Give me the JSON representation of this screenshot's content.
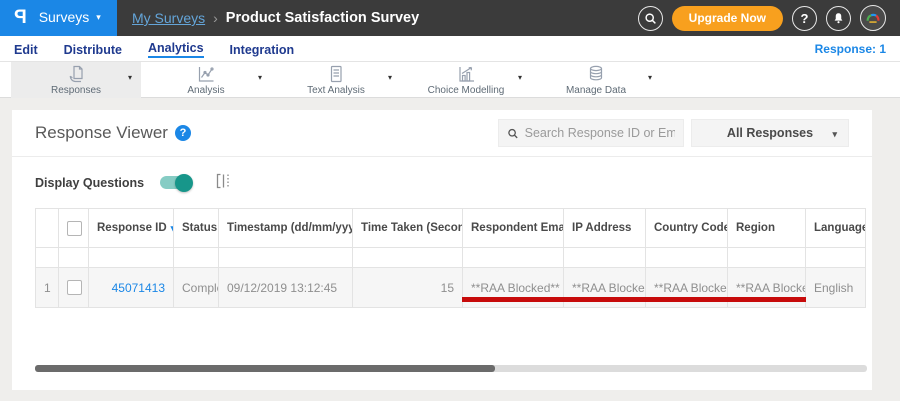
{
  "topbar": {
    "logo": "P",
    "product_menu": "Surveys",
    "breadcrumb": {
      "parent": "My Surveys",
      "separator": "›",
      "current": "Product Satisfaction Survey"
    },
    "upgrade_label": "Upgrade Now"
  },
  "nav": {
    "items": [
      {
        "label": "Edit"
      },
      {
        "label": "Distribute"
      },
      {
        "label": "Analytics"
      },
      {
        "label": "Integration"
      }
    ],
    "response_count": "Response: 1"
  },
  "toolbar": {
    "items": [
      {
        "label": "Responses"
      },
      {
        "label": "Analysis"
      },
      {
        "label": "Text Analysis"
      },
      {
        "label": "Choice Modelling"
      },
      {
        "label": "Manage Data"
      }
    ]
  },
  "viewer": {
    "title": "Response Viewer",
    "search_placeholder": "Search Response ID or Email",
    "filter_dropdown": "All Responses",
    "display_questions_label": "Display Questions",
    "toggle_state": "on"
  },
  "table": {
    "header": {
      "response_id": "Response ID",
      "status": "Status",
      "timestamp": "Timestamp (dd/mm/yyyy)",
      "time_taken": "Time Taken (Seconds)",
      "respondent_email": "Respondent Email",
      "ip_address": "IP Address",
      "country_code": "Country Code",
      "region": "Region",
      "language": "Language"
    },
    "rows": [
      {
        "index": "1",
        "response_id": "45071413",
        "status": "Completed",
        "timestamp": "09/12/2019 13:12:45",
        "time_taken": "15",
        "respondent_email": "**RAA Blocked**",
        "ip_address": "**RAA Blocked**",
        "country_code": "**RAA Blocked**",
        "region": "**RAA Blocked**",
        "language": "English"
      }
    ]
  },
  "icons": {
    "caret_down": "▾",
    "sort_desc": "▾",
    "sort_both": "⇅",
    "help": "?"
  },
  "colors": {
    "accent_blue": "#1b87e6",
    "nav_navy": "#1f3a8f",
    "upgrade_orange": "#f8a01e",
    "toggle_teal": "#17968a",
    "annotation_red": "#c70b0b",
    "topbar_dark": "#3b3b3b"
  }
}
